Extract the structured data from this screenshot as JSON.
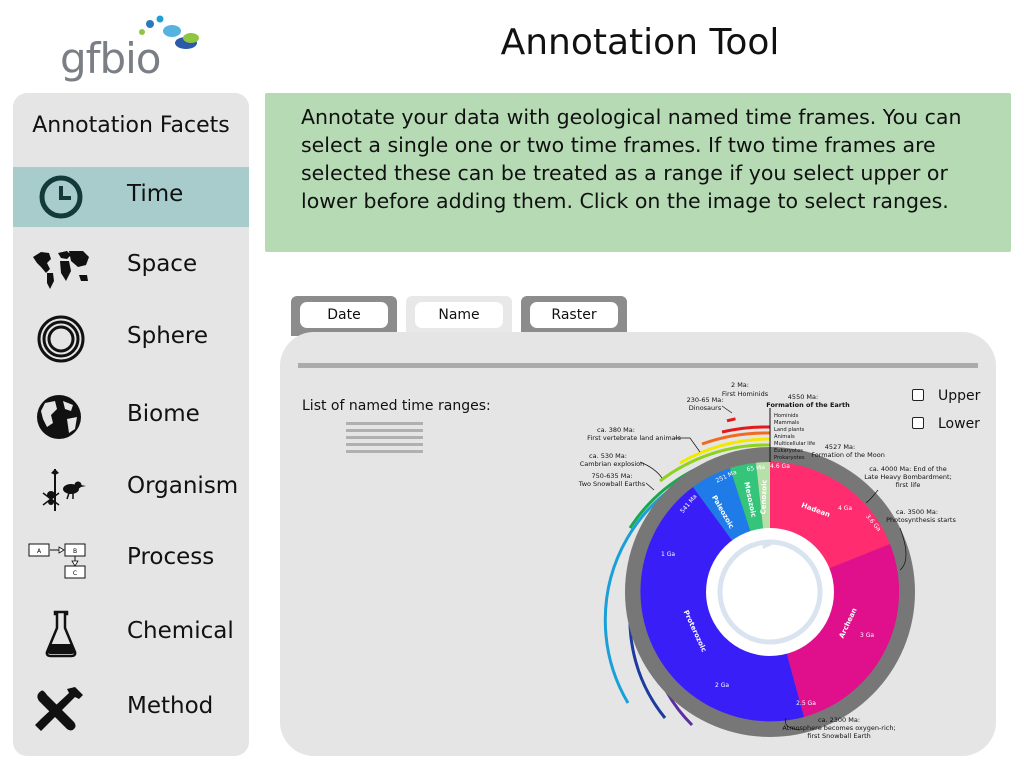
{
  "app": {
    "logo_text": "gfbio",
    "title": "Annotation Tool"
  },
  "sidebar": {
    "title": "Annotation Facets",
    "items": [
      {
        "label": "Time",
        "icon": "clock-icon",
        "active": true
      },
      {
        "label": "Space",
        "icon": "world-map-icon",
        "active": false
      },
      {
        "label": "Sphere",
        "icon": "concentric-circles-icon",
        "active": false
      },
      {
        "label": "Biome",
        "icon": "globe-icon",
        "active": false
      },
      {
        "label": "Organism",
        "icon": "organism-icon",
        "active": false
      },
      {
        "label": "Process",
        "icon": "process-flow-icon",
        "active": false
      },
      {
        "label": "Chemical",
        "icon": "flask-icon",
        "active": false
      },
      {
        "label": "Method",
        "icon": "tools-icon",
        "active": false
      }
    ],
    "process_icon_labels": [
      "A",
      "B",
      "C"
    ]
  },
  "info": {
    "text": "Annotate your data with geological named time frames. You can select a single one or two time frames. If two time frames are selected these can be treated as a range if you select upper or lower before adding them. Click on the image to select ranges."
  },
  "tabs": [
    {
      "label": "Date",
      "active": false
    },
    {
      "label": "Name",
      "active": true
    },
    {
      "label": "Raster",
      "active": false
    }
  ],
  "panel": {
    "list_title": "List of named time ranges:",
    "options": [
      {
        "label": "Upper",
        "checked": false
      },
      {
        "label": "Lower",
        "checked": false
      }
    ]
  },
  "clock_chart": {
    "eons": [
      {
        "name": "Hadean",
        "color": "#ff2d6f"
      },
      {
        "name": "Archean",
        "color": "#e0108c"
      },
      {
        "name": "Proterozoic",
        "color": "#3a1ef7"
      },
      {
        "name": "Paleozoic",
        "color": "#1e7be8"
      },
      {
        "name": "Mesozoic",
        "color": "#34c47a"
      },
      {
        "name": "Cenozoic",
        "color": "#b6e0a8"
      }
    ],
    "ring_labels": [
      "4.6 Ga",
      "4 Ga",
      "3.6 Ga",
      "3 Ga",
      "2.5 Ga",
      "2 Ga",
      "1 Ga",
      "541 Ma",
      "251 Ma",
      "65 Ma"
    ],
    "top_marker_items": [
      "Hominids",
      "Mammals",
      "Land plants",
      "Animals",
      "Multicellular life",
      "Eukaryotes",
      "Prokaryotes"
    ],
    "annotations": {
      "hominids": [
        "2 Ma:",
        "First Hominids"
      ],
      "earth": [
        "4550 Ma:",
        "Formation of the Earth"
      ],
      "dinosaurs": [
        "230-65 Ma:",
        "Dinosaurs"
      ],
      "moon": [
        "4527 Ma:",
        "Formation of the Moon"
      ],
      "vertebrate": [
        "ca. 380 Ma:",
        "First vertebrate land animals"
      ],
      "cambrian": [
        "ca. 530 Ma:",
        "Cambrian explosion"
      ],
      "snowball": [
        "750-635 Ma:",
        "Two Snowball Earths"
      ],
      "bombardment": [
        "ca. 4000 Ma: End of the",
        "Late Heavy Bombardment;",
        "first life"
      ],
      "photosynthesis": [
        "ca. 3500 Ma:",
        "Photosynthesis starts"
      ],
      "oxygen": [
        "ca. 2300 Ma:",
        "Atmosphere becomes oxygen-rich;",
        "first Snowball Earth"
      ]
    }
  }
}
